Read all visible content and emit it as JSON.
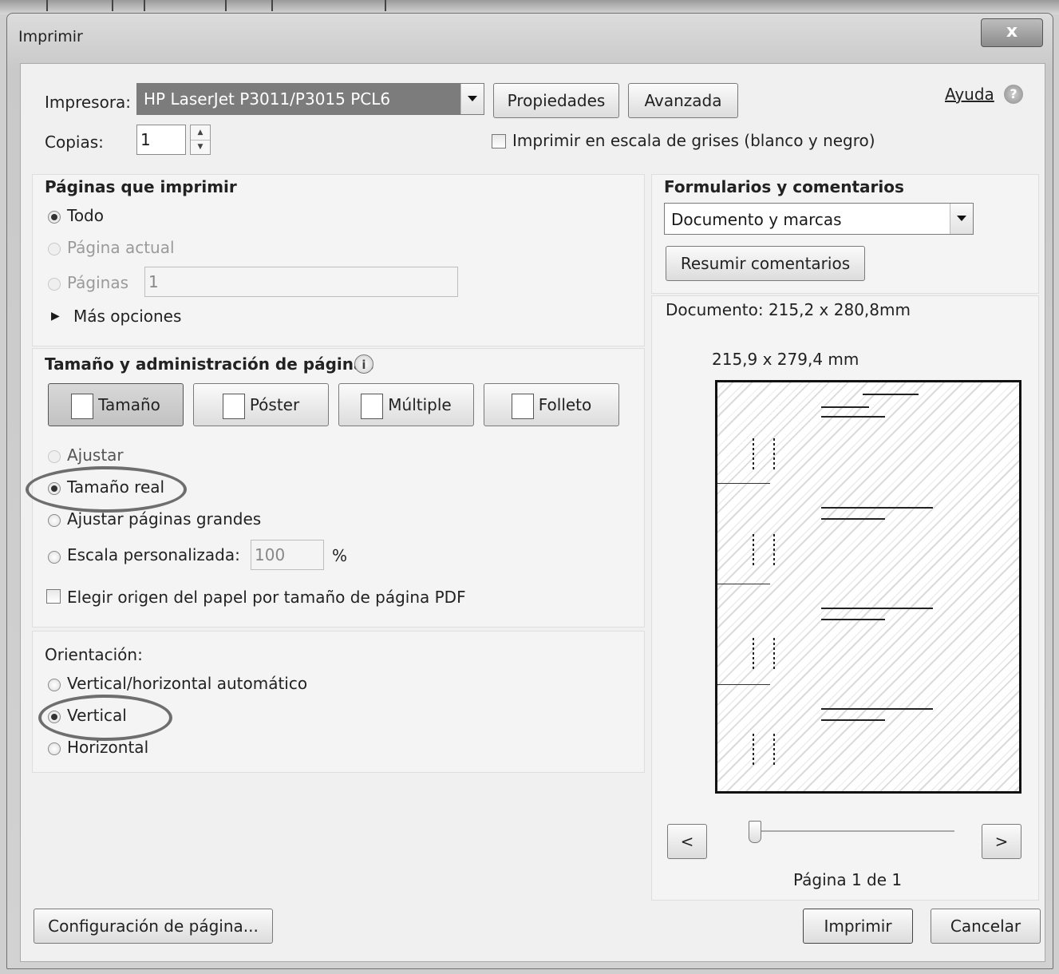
{
  "dialog": {
    "title": "Imprimir",
    "close_label": "x"
  },
  "printer": {
    "label": "Impresora:",
    "selected": "HP LaserJet P3011/P3015 PCL6",
    "properties_button": "Propiedades",
    "advanced_button": "Avanzada",
    "help_link": "Ayuda",
    "copies_label": "Copias:",
    "copies_value": "1",
    "grayscale_label": "Imprimir en escala de grises (blanco y negro)",
    "grayscale_checked": false
  },
  "pages_to_print": {
    "heading": "Páginas que imprimir",
    "options": [
      {
        "label": "Todo",
        "selected": true,
        "enabled": true
      },
      {
        "label": "Página actual",
        "selected": false,
        "enabled": false
      },
      {
        "label": "Páginas",
        "selected": false,
        "enabled": false
      }
    ],
    "pages_value": "1",
    "more_options": "Más opciones"
  },
  "page_handling": {
    "heading": "Tamaño y administración de páginas",
    "tabs": [
      {
        "label": "Tamaño",
        "icon": "size-icon",
        "active": true
      },
      {
        "label": "Póster",
        "icon": "poster-icon",
        "active": false
      },
      {
        "label": "Múltiple",
        "icon": "multiple-icon",
        "active": false
      },
      {
        "label": "Folleto",
        "icon": "booklet-icon",
        "active": false
      }
    ],
    "options": [
      {
        "label": "Ajustar",
        "selected": false,
        "enabled": false
      },
      {
        "label": "Tamaño real",
        "selected": true,
        "enabled": true
      },
      {
        "label": "Ajustar páginas grandes",
        "selected": false,
        "enabled": true
      },
      {
        "label": "Escala personalizada:",
        "selected": false,
        "enabled": true
      }
    ],
    "scale_value": "100",
    "scale_unit": "%",
    "paper_source_label": "Elegir origen del papel por tamaño de página PDF",
    "paper_source_checked": false
  },
  "orientation": {
    "heading": "Orientación:",
    "options": [
      {
        "label": "Vertical/horizontal automático",
        "selected": false
      },
      {
        "label": "Vertical",
        "selected": true
      },
      {
        "label": "Horizontal",
        "selected": false
      }
    ]
  },
  "forms_comments": {
    "heading": "Formularios y comentarios",
    "selected": "Documento y marcas",
    "summarize_button": "Resumir comentarios"
  },
  "preview": {
    "document_size": "Documento: 215,2 x 280,8mm",
    "paper_size": "215,9 x 279,4 mm",
    "prev_button": "<",
    "next_button": ">",
    "page_indicator": "Página 1 de 1",
    "page_position": 1,
    "page_total": 1
  },
  "footer": {
    "page_setup_button": "Configuración de página...",
    "print_button": "Imprimir",
    "cancel_button": "Cancelar"
  }
}
